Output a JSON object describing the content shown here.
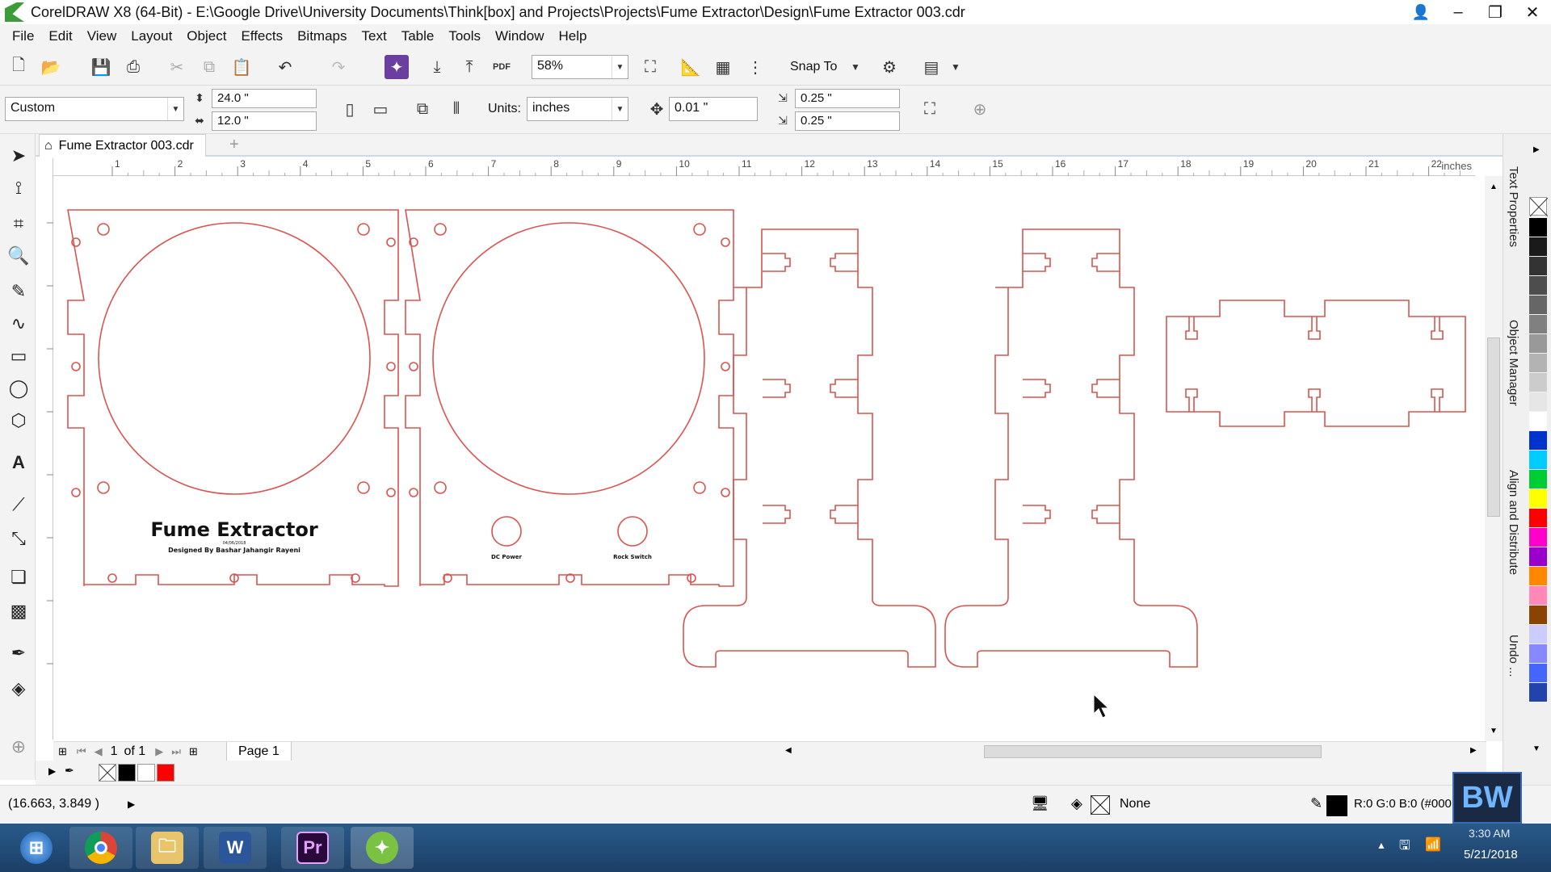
{
  "window": {
    "title": "CorelDRAW X8 (64-Bit) - E:\\Google Drive\\University Documents\\Think[box] and Projects\\Projects\\Fume Extractor\\Design\\Fume Extractor 003.cdr",
    "minimize": "–",
    "restore": "❐",
    "close": "✕"
  },
  "menu": [
    "File",
    "Edit",
    "View",
    "Layout",
    "Object",
    "Effects",
    "Bitmaps",
    "Text",
    "Table",
    "Tools",
    "Window",
    "Help"
  ],
  "toolbar": {
    "zoom": "58%",
    "snap_to": "Snap To",
    "pdf_label": "PDF"
  },
  "property_bar": {
    "page_preset": "Custom",
    "page_width": "24.0 \"",
    "page_height": "12.0 \"",
    "units_label": "Units:",
    "units": "inches",
    "nudge": "0.01 \"",
    "dup_x": "0.25 \"",
    "dup_y": "0.25 \""
  },
  "document_tab": "Fume Extractor 003.cdr",
  "ruler": {
    "ticks": [
      "1",
      "2",
      "3",
      "4",
      "5",
      "6",
      "7",
      "8",
      "9",
      "10",
      "11",
      "12",
      "13",
      "14",
      "15",
      "16",
      "17",
      "18",
      "19",
      "20",
      "21",
      "22"
    ],
    "unit": "inches"
  },
  "design": {
    "panel_title": "Fume Extractor",
    "panel_subtitle": "Designed By Bashar Jahangir Rayeni",
    "panel_small": "04/06/2018",
    "dc_power_label": "DC Power",
    "rocker_label": "Rock Switch",
    "stroke_color": "#d9534f"
  },
  "page_nav": {
    "current": "1",
    "of_label": "of 1",
    "page_tab": "Page 1"
  },
  "docker_labels": [
    "Text Properties",
    "Object Manager",
    "Align and Distribute",
    "Undo ..."
  ],
  "status": {
    "coords": "(16.663, 3.849 )",
    "fill_label": "None",
    "outline_info": "R:0 G:0 B:0 (#000"
  },
  "palette": [
    "#000000",
    "#1a1a1a",
    "#333333",
    "#4d4d4d",
    "#666666",
    "#808080",
    "#999999",
    "#b3b3b3",
    "#cccccc",
    "#e6e6e6",
    "#ffffff",
    "#0033cc",
    "#00ccff",
    "#00cc33",
    "#ffff00",
    "#ff0000",
    "#ff00cc",
    "#9900cc",
    "#ff8800",
    "#ff88bb",
    "#884400",
    "#ccccff",
    "#8888ff",
    "#4466ff",
    "#2244aa"
  ],
  "taskbar": {
    "time": "3:30 AM",
    "date": "5/21/2018",
    "apps": [
      "Start",
      "Chrome",
      "File Explorer",
      "Word",
      "Premiere",
      "CorelDRAW"
    ],
    "premiere_label": "Pr",
    "word_label": "W"
  },
  "watermark": "BW"
}
